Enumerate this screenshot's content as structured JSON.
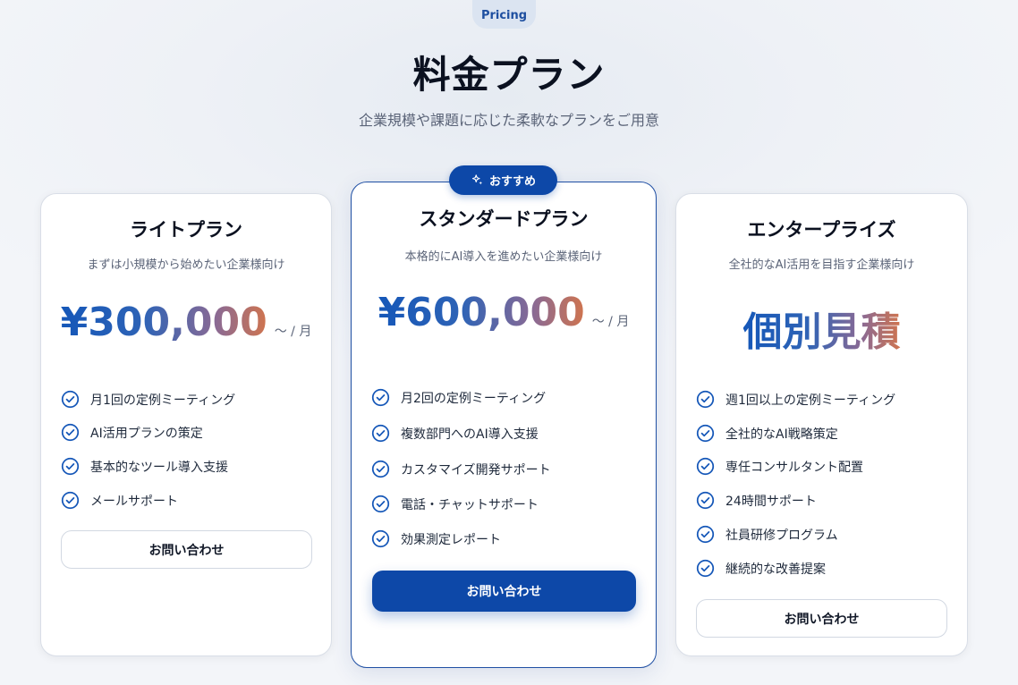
{
  "header": {
    "eyebrow": "Pricing",
    "title": "料金プラン",
    "subtitle": "企業規模や課題に応じた柔軟なプランをご用意"
  },
  "plans": [
    {
      "name": "ライトプラン",
      "description": "まずは小規模から始めたい企業様向け",
      "price": "¥300,000",
      "period": "～ / 月",
      "features": [
        "月1回の定例ミーティング",
        "AI活用プランの策定",
        "基本的なツール導入支援",
        "メールサポート"
      ],
      "cta": "お問い合わせ"
    },
    {
      "badge": "おすすめ",
      "name": "スタンダードプラン",
      "description": "本格的にAI導入を進めたい企業様向け",
      "price": "¥600,000",
      "period": "～ / 月",
      "features": [
        "月2回の定例ミーティング",
        "複数部門へのAI導入支援",
        "カスタマイズ開発サポート",
        "電話・チャットサポート",
        "効果測定レポート"
      ],
      "cta": "お問い合わせ"
    },
    {
      "name": "エンタープライズ",
      "description": "全社的なAI活用を目指す企業様向け",
      "price": "個別見積",
      "features": [
        "週1回以上の定例ミーティング",
        "全社的なAI戦略策定",
        "専任コンサルタント配置",
        "24時間サポート",
        "社員研修プログラム",
        "継続的な改善提案"
      ],
      "cta": "お問い合わせ"
    }
  ],
  "colors": {
    "accent": "#0d48a8",
    "check": "#1557b8",
    "gradient_start": "#1557b8",
    "gradient_end": "#d0744e"
  },
  "icons": {
    "check": "check-circle-icon",
    "badge": "sparkle-icon"
  }
}
